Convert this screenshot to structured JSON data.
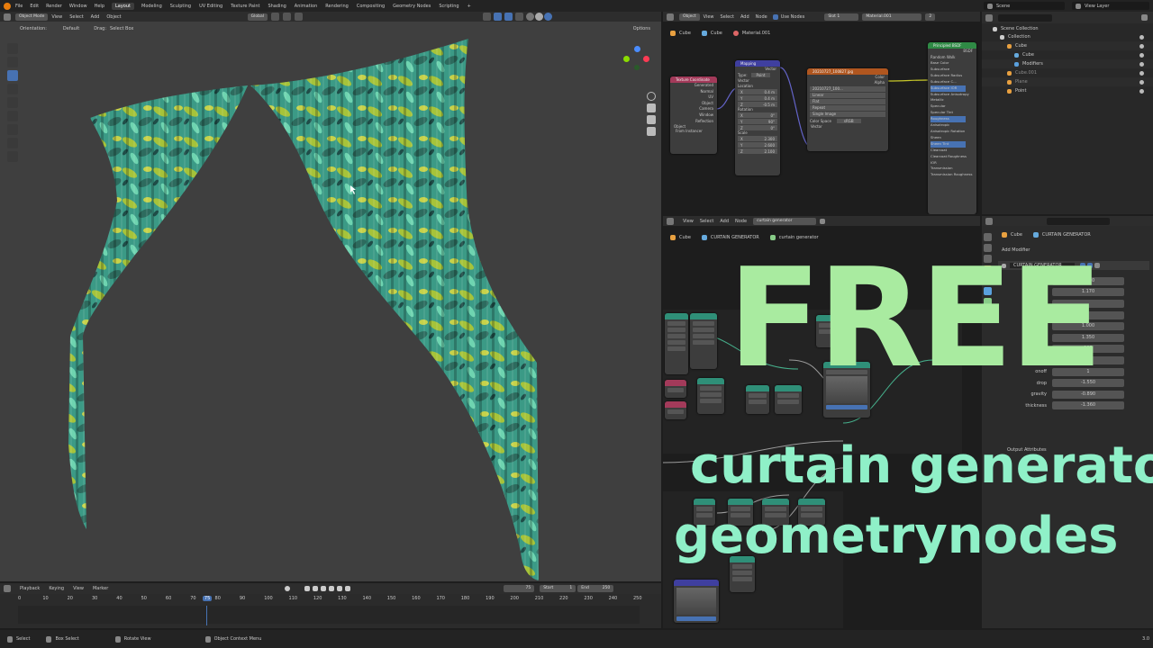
{
  "topbar": {
    "menus": [
      "File",
      "Edit",
      "Render",
      "Window",
      "Help"
    ],
    "workspaces": [
      "Layout",
      "Modeling",
      "Sculpting",
      "UV Editing",
      "Texture Paint",
      "Shading",
      "Animation",
      "Rendering",
      "Compositing",
      "Geometry Nodes",
      "Scripting"
    ],
    "active_workspace": "Layout",
    "add_tab": "+",
    "scene": "Scene",
    "view_layer": "View Layer"
  },
  "viewport": {
    "mode": "Object Mode",
    "menus": [
      "View",
      "Select",
      "Add",
      "Object"
    ],
    "orientation_label": "Orientation:",
    "orientation_value": "Default",
    "drag_label": "Drag:",
    "drag_value": "Select Box",
    "transform_space": "Global",
    "options": "Options"
  },
  "shader_editor": {
    "type": "Object",
    "menus": [
      "View",
      "Select",
      "Add",
      "Node"
    ],
    "use_nodes": "Use Nodes",
    "slot": "Slot 1",
    "material": "Material.001",
    "users": "2",
    "breadcrumb": [
      "Cube",
      "Cube",
      "Material.001"
    ],
    "nodes": {
      "texcoord": {
        "title": "Texture Coordinate",
        "outputs": [
          "Generated",
          "Normal",
          "UV",
          "Object",
          "Camera",
          "Window",
          "Reflection"
        ],
        "object_label": "Object",
        "from_instancer": "From Instancer"
      },
      "mapping": {
        "title": "Mapping",
        "vector": "Vector",
        "type_label": "Type:",
        "type_value": "Point",
        "location": "Location",
        "rotation": "Rotation",
        "scale": "Scale",
        "axes": [
          "X",
          "Y",
          "Z"
        ],
        "loc": [
          "0.4 m",
          "0.4 m",
          "-0.5 m"
        ],
        "rot": [
          "0°",
          "90°",
          "0°"
        ],
        "scl": [
          "2.300",
          "2.600",
          "2.100"
        ]
      },
      "image": {
        "title": "20210727_100827.jpg",
        "file": "20210727_100...",
        "outputs": [
          "Color",
          "Alpha"
        ],
        "interp": "Linear",
        "proj": "Flat",
        "ext": "Repeat",
        "source": "Single Image",
        "cs_label": "Color Space",
        "cs_value": "sRGB",
        "vector": "Vector"
      },
      "bsdf": {
        "title": "Principled BSDF",
        "output": "BSDF",
        "ss_method": "Random Walk",
        "inputs": [
          "Base Color",
          "Subsurface",
          "Subsurface Radius",
          "Subsurface C...",
          "Subsurface IOR",
          "Subsurface Anisotropy",
          "Metallic",
          "Specular",
          "Specular Tint",
          "Roughness",
          "Anisotropic",
          "Anisotropic Rotation",
          "Sheen",
          "Sheen Tint",
          "Clearcoat",
          "Clearcoat Roughness",
          "IOR",
          "Transmission",
          "Transmission Roughness"
        ]
      }
    }
  },
  "outliner": {
    "root": "Scene Collection",
    "items": [
      {
        "name": "Collection",
        "depth": 1
      },
      {
        "name": "Cube",
        "depth": 2
      },
      {
        "name": "Cube",
        "depth": 3
      },
      {
        "name": "Modifiers",
        "depth": 3
      },
      {
        "name": "Cube.001",
        "depth": 2
      },
      {
        "name": "Plane",
        "depth": 2
      },
      {
        "name": "Point",
        "depth": 2
      }
    ]
  },
  "geo_editor": {
    "menus": [
      "View",
      "Select",
      "Add",
      "Node"
    ],
    "tree_name": "curtain generator",
    "breadcrumb": [
      "Cube",
      "CURTAIN GENERATOR",
      "curtain generator"
    ]
  },
  "properties": {
    "breadcrumb": [
      "Cube",
      "CURTAIN GENERATOR"
    ],
    "add_modifier": "Add Modifier",
    "modifier_name": "CURTAIN GENERATOR",
    "fields": [
      {
        "label": "",
        "value": "1.320"
      },
      {
        "label": "",
        "value": "1.170"
      },
      {
        "label": "s",
        "value": ""
      },
      {
        "label": "folds th",
        "value": ""
      },
      {
        "label": "fold",
        "value": "1.000"
      },
      {
        "label": "ope",
        "value": "1.350"
      },
      {
        "label": "sub",
        "value": "103"
      },
      {
        "label": "sub",
        "value": ""
      },
      {
        "label": "onoff",
        "value": "1"
      },
      {
        "label": "drop",
        "value": "-1.550"
      },
      {
        "label": "gravity",
        "value": "-0.890"
      },
      {
        "label": "thickness",
        "value": "-1.360"
      }
    ],
    "output_attributes": "Output Attributes"
  },
  "timeline": {
    "menus": [
      "Playback",
      "Keying",
      "View",
      "Marker"
    ],
    "current_frame": "75",
    "start_label": "Start",
    "start": "1",
    "end_label": "End",
    "end": "250",
    "ticks": [
      "0",
      "10",
      "20",
      "30",
      "40",
      "50",
      "60",
      "70",
      "75",
      "80",
      "90",
      "100",
      "110",
      "120",
      "130",
      "140",
      "150",
      "160",
      "170",
      "180",
      "190",
      "200",
      "210",
      "220",
      "230",
      "240",
      "250"
    ]
  },
  "statusbar": {
    "items": [
      "Select",
      "Box Select",
      "Rotate View",
      "Object Context Menu"
    ],
    "version": "3.0"
  },
  "overlay": {
    "headline": "FREE",
    "line1": "curtain generator",
    "line2": "geometrynodes"
  },
  "colors": {
    "accent": "#4772b3",
    "headline": "#a9eba0",
    "subline": "#8ff0c8",
    "playhead": "#4772b3"
  }
}
